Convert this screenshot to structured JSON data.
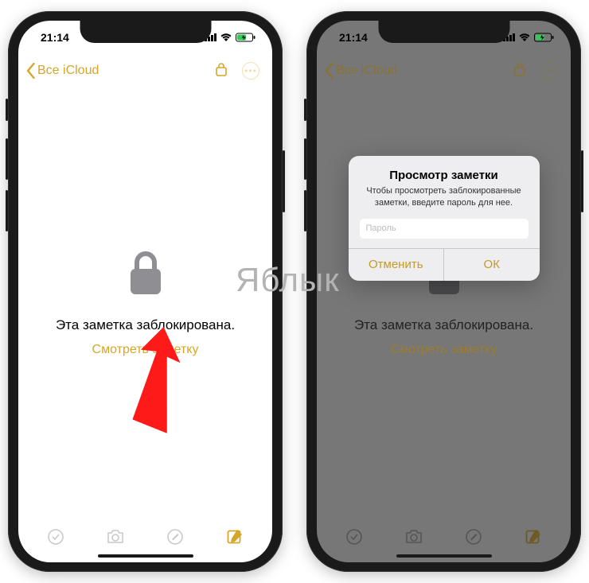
{
  "status": {
    "time": "21:14"
  },
  "nav": {
    "back_label": "Все iCloud"
  },
  "main": {
    "locked_message": "Эта заметка заблокирована.",
    "view_note": "Смотреть заметку"
  },
  "dialog": {
    "title": "Просмотр заметки",
    "description": "Чтобы просмотреть заблокированные заметки, введите пароль для нее.",
    "placeholder": "Пароль",
    "cancel": "Отменить",
    "ok": "ОК"
  },
  "watermark": "Яблык",
  "colors": {
    "accent": "#d6a62a",
    "dim": "#777777"
  }
}
